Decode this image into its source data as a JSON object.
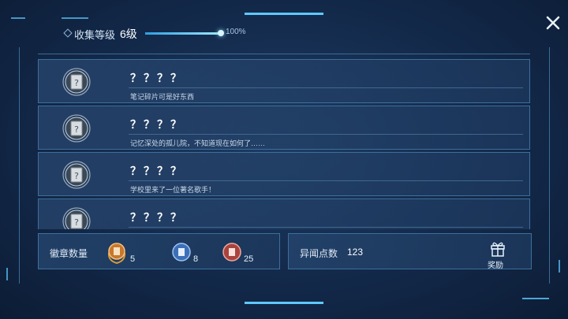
{
  "header": {
    "collect_label": "收集等级",
    "level": "6级",
    "progress_text": "100%",
    "progress": 1.0
  },
  "items": [
    {
      "title": "？？？？",
      "desc": "笔记碎片可是好东西"
    },
    {
      "title": "？？？？",
      "desc": "记忆深处的孤儿院，不知道现在如何了……"
    },
    {
      "title": "？？？？",
      "desc": "学校里来了一位著名歌手！"
    },
    {
      "title": "？？？？",
      "desc": ""
    }
  ],
  "medals": {
    "label": "徽章数量",
    "gold_count": "5",
    "blue_count": "8",
    "red_count": "25"
  },
  "points": {
    "label": "异闻点数",
    "value": "123",
    "reward_label": "奖励"
  },
  "colors": {
    "accent": "#5fc8ff",
    "gold": "#d89a3a",
    "blue": "#5b8fd6",
    "red": "#c8564e"
  }
}
